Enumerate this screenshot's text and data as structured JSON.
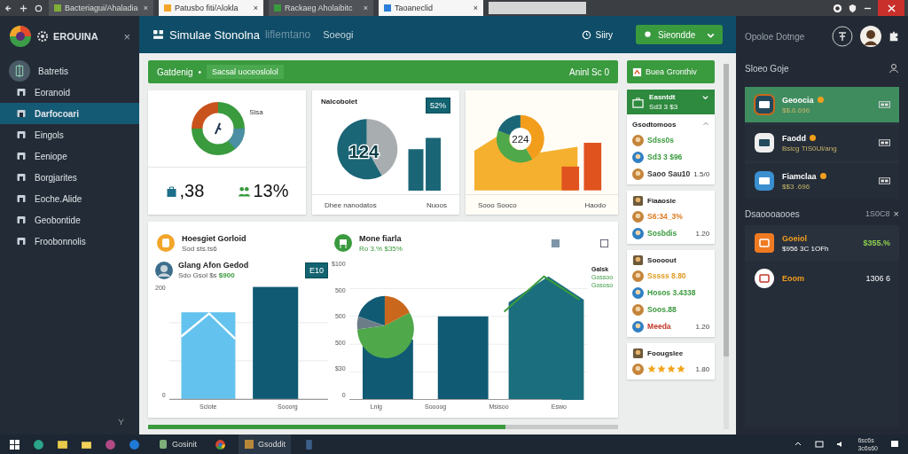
{
  "browser": {
    "tabs": [
      {
        "title": "Bacteriagui/Ahaladia",
        "close": "×",
        "selected": false
      },
      {
        "title": "Patusbo fiti/Alokla",
        "close": "×",
        "selected": true
      },
      {
        "title": "Rackaeg Aholaibitc",
        "close": "×",
        "selected": false
      },
      {
        "title": "Taoaneclid",
        "close": "×",
        "selected": true
      }
    ]
  },
  "sidebar": {
    "brand": "EROUINA",
    "close": "×",
    "items": [
      {
        "label": "Batretis",
        "selected": false
      },
      {
        "label": "Eoranoid",
        "selected": false
      },
      {
        "label": "Darfocoari",
        "selected": true
      },
      {
        "label": "Eingols",
        "selected": false
      },
      {
        "label": "Eeniope",
        "selected": false
      },
      {
        "label": "Borgjarites",
        "selected": false
      },
      {
        "label": "Eoche.Alide",
        "selected": false
      },
      {
        "label": "Geobontide",
        "selected": false
      },
      {
        "label": "Froobonnolis",
        "selected": false
      }
    ]
  },
  "header": {
    "title": "Simulae Stonolna",
    "subtitle": "liflemtano",
    "search": "Soeogi",
    "status": "Siiry",
    "button": "Sieondde"
  },
  "banner": {
    "title": "Gatdenig",
    "separator": "•",
    "chip": "Sacsal uoceoslolol",
    "right": "Aninl Sc 0"
  },
  "cards": [
    {
      "kind": "donut",
      "label": "Sisa",
      "stats": [
        ",38",
        "13%"
      ]
    },
    {
      "kind": "pie",
      "title": "Nalcobolet",
      "badge": "52%",
      "center": "124",
      "captions": [
        "Dhee nanodatos",
        "Nuoos"
      ]
    },
    {
      "kind": "area",
      "center": "224",
      "captions": [
        "Sooo Sooco",
        "Haodo"
      ]
    }
  ],
  "overview": {
    "heads": [
      {
        "title": "Hoesgiet Gorloid",
        "sub": "Sod sts.ts6"
      },
      {
        "title": "Mone fiarla",
        "sub": "Ro 3.% $35%"
      }
    ],
    "person": {
      "name": "Glang Afon Gedod",
      "sub": "Sdo Gsol $s",
      "amount": "$900",
      "badge": "E10"
    },
    "left_chart": {
      "y_labels": [
        "200",
        "0"
      ],
      "x_labels": [
        "Sclote",
        "Sooorg"
      ]
    },
    "right_chart": {
      "y_labels": [
        "$100",
        "500",
        "500",
        "500",
        "$30",
        "0"
      ],
      "x_labels": [
        "Lnlg",
        "Soooog",
        "Msisoo",
        "Eswo"
      ],
      "legend": [
        "Galsk",
        "Gossoo",
        "Gososo"
      ]
    },
    "progress": {
      "level": 0.76
    }
  },
  "side": {
    "button": "Buea Gronthiv",
    "account": {
      "title": "Easntdt",
      "sub": "Sd3 3 $3"
    },
    "groups": [
      {
        "title": "Gsodtomoos",
        "rows": [
          {
            "text": "Sdss0s",
            "color": "#3a9a3e"
          },
          {
            "text": "Sd3 3 $96",
            "color": "#3a9a3e"
          },
          {
            "text": "Saoo Sau10",
            "color": "#333333",
            "value": "1.5/0"
          }
        ]
      },
      {
        "title": "Fiaaosie",
        "rows": [
          {
            "text": "S6:34_3%",
            "color": "#e07a1f"
          },
          {
            "text": "Sosbdis",
            "color": "#3a9a3e",
            "value": "1.20"
          }
        ]
      },
      {
        "title": "Soooout",
        "rows": [
          {
            "text": "Sssss 8.80",
            "color": "#e09a1f"
          },
          {
            "text": "Hosos 3.4338",
            "color": "#3a9a3e"
          },
          {
            "text": "Soos.88",
            "color": "#3a9a3e"
          },
          {
            "text": "Meeda",
            "color": "#c0392b",
            "value": "1.20"
          }
        ]
      },
      {
        "title": "Foougslee",
        "stars": 4,
        "value": "1.80"
      }
    ]
  },
  "panel": {
    "title": "Opoloe Dotnge",
    "list_title": "Sloeo Goje",
    "items": [
      {
        "title": "Geoocia",
        "sub": "$$.6.696",
        "selected": true
      },
      {
        "title": "Faodd",
        "sub": "Bsicg TIS0Ul/ang",
        "selected": false
      },
      {
        "title": "Fiamclaa",
        "sub": "$$3 .696",
        "selected": false
      }
    ],
    "section": {
      "title": "Dsaoooaooes",
      "count": "1S0C8",
      "close": "×"
    },
    "entries": [
      {
        "title": "Goeiol",
        "sub": "$956 3C 1OFh",
        "value": "$355.%"
      },
      {
        "title": "Eoom",
        "value": "1306 6"
      }
    ]
  },
  "taskbar": {
    "apps": [
      {
        "label": "Gosinit"
      },
      {
        "label": "Gsoddit"
      }
    ],
    "clock": {
      "time": "6sc6s",
      "date": "3c6s60"
    }
  }
}
